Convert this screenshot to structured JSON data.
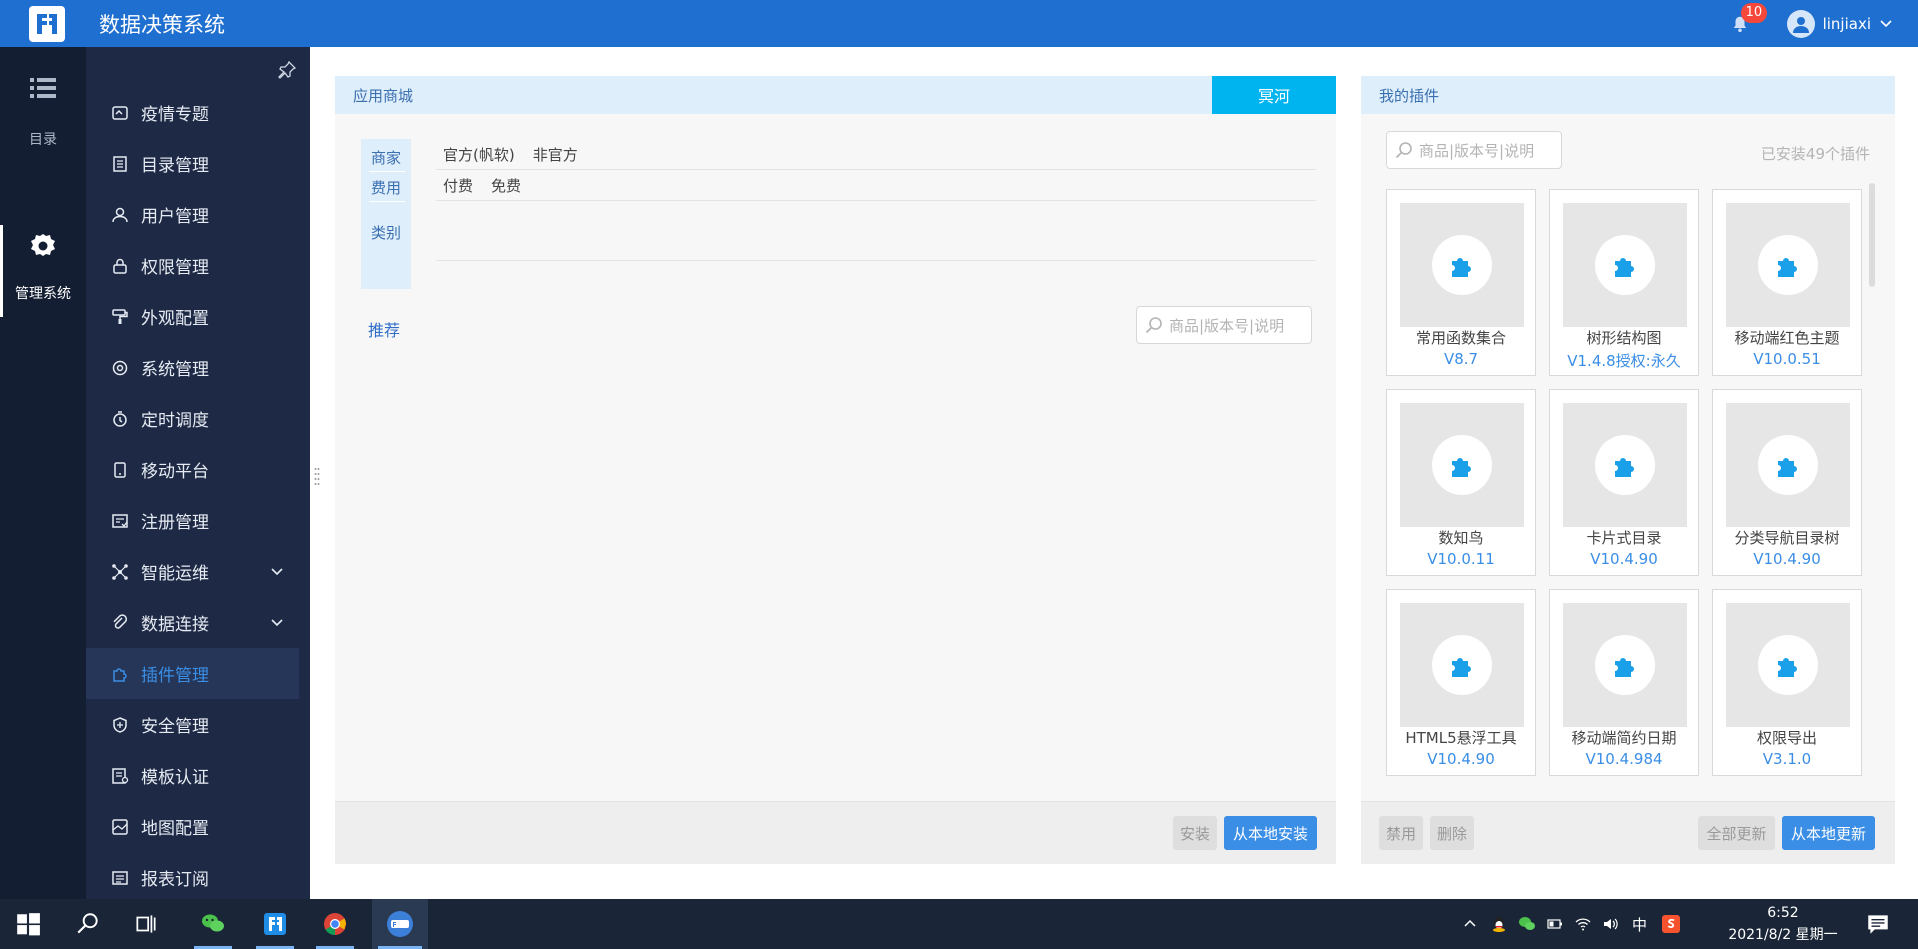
{
  "header": {
    "app_title": "数据决策系统",
    "notification_count": "10",
    "username": "linjiaxi"
  },
  "rail": {
    "items": [
      {
        "label": "目录",
        "icon": "list-icon"
      },
      {
        "label": "管理系统",
        "icon": "gear-icon"
      }
    ]
  },
  "sidebar": {
    "items": [
      {
        "label": "疫情专题",
        "icon": "dashboard-icon"
      },
      {
        "label": "目录管理",
        "icon": "document-icon"
      },
      {
        "label": "用户管理",
        "icon": "user-icon"
      },
      {
        "label": "权限管理",
        "icon": "lock-icon"
      },
      {
        "label": "外观配置",
        "icon": "paint-icon"
      },
      {
        "label": "系统管理",
        "icon": "settings-icon"
      },
      {
        "label": "定时调度",
        "icon": "timer-icon"
      },
      {
        "label": "移动平台",
        "icon": "mobile-icon"
      },
      {
        "label": "注册管理",
        "icon": "register-icon"
      },
      {
        "label": "智能运维",
        "icon": "network-icon"
      },
      {
        "label": "数据连接",
        "icon": "link-icon"
      },
      {
        "label": "插件管理",
        "icon": "plugin-icon"
      },
      {
        "label": "安全管理",
        "icon": "shield-icon"
      },
      {
        "label": "模板认证",
        "icon": "certificate-icon"
      },
      {
        "label": "地图配置",
        "icon": "map-icon"
      },
      {
        "label": "报表订阅",
        "icon": "report-icon"
      }
    ]
  },
  "store": {
    "title": "应用商城",
    "tab": "冥河",
    "filter_labels": {
      "vendor": "商家",
      "fee": "费用",
      "category": "类别"
    },
    "vendor_options": [
      "官方(帆软)",
      "非官方"
    ],
    "fee_options": [
      "付费",
      "免费"
    ],
    "recommend": "推荐",
    "search_placeholder": "商品|版本号|说明",
    "buttons": {
      "install": "安装",
      "install_local": "从本地安装"
    }
  },
  "mine": {
    "title": "我的插件",
    "search_placeholder": "商品|版本号|说明",
    "installed_count": "已安装49个插件",
    "plugins": [
      {
        "name": "常用函数集合",
        "version": "V8.7"
      },
      {
        "name": "树形结构图",
        "version": "V1.4.8授权:永久"
      },
      {
        "name": "移动端红色主题",
        "version": "V10.0.51"
      },
      {
        "name": "数知鸟",
        "version": "V10.0.11"
      },
      {
        "name": "卡片式目录",
        "version": "V10.4.90"
      },
      {
        "name": "分类导航目录树",
        "version": "V10.4.90"
      },
      {
        "name": "HTML5悬浮工具",
        "version": "V10.4.90"
      },
      {
        "name": "移动端简约日期",
        "version": "V10.4.984"
      },
      {
        "name": "权限导出",
        "version": "V3.1.0"
      }
    ],
    "buttons": {
      "disable": "禁用",
      "delete": "删除",
      "update_all": "全部更新",
      "update_local": "从本地更新"
    }
  },
  "taskbar": {
    "ime": "中",
    "time": "6:52",
    "date": "2021/8/2 星期一"
  },
  "colors": {
    "topbar": "#1f6fd0",
    "rail": "#141e33",
    "sidebar": "#1e2a45",
    "accent": "#3a8ee6",
    "tab": "#00b4ef"
  }
}
